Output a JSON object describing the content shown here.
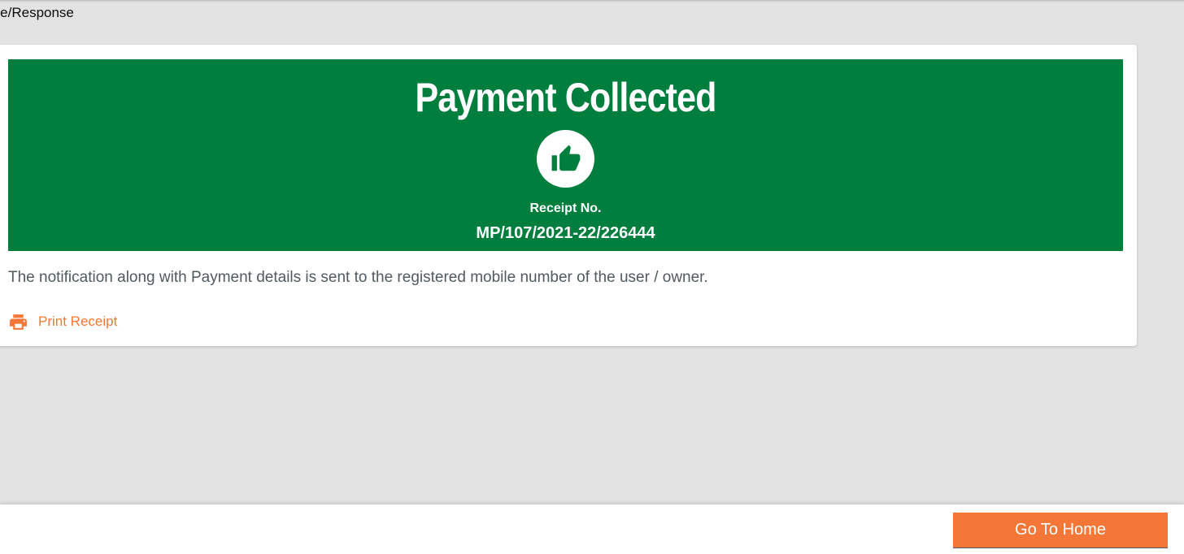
{
  "breadcrumb": {
    "text": "me/Response"
  },
  "banner": {
    "title": "Payment Collected",
    "icon": "thumbs-up-icon",
    "receipt_label": "Receipt No.",
    "receipt_number": "MP/107/2021-22/226444",
    "background_color": "#007e3d"
  },
  "notification": {
    "text": "The notification along with Payment details is sent to the registered mobile number of the user / owner."
  },
  "actions": {
    "print_label": "Print Receipt",
    "print_icon": "printer-icon"
  },
  "footer": {
    "home_button_label": "Go To Home",
    "accent_color": "#f47738"
  }
}
